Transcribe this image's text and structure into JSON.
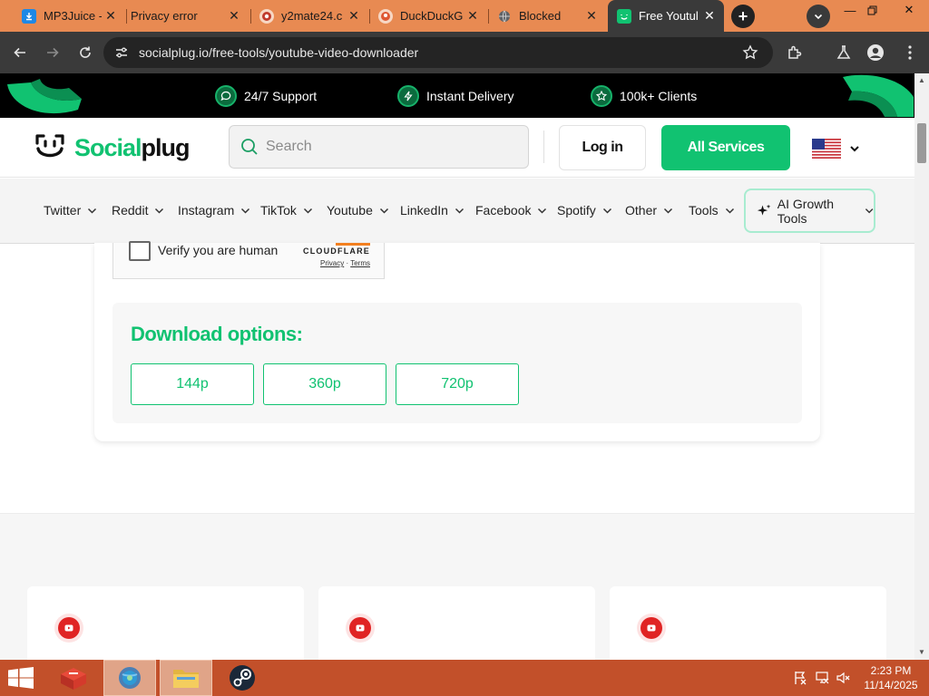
{
  "browser": {
    "tabs": [
      {
        "title": "MP3Juice -",
        "icon": "download-icon",
        "active": false
      },
      {
        "title": "Privacy error",
        "icon": "none",
        "active": false
      },
      {
        "title": "y2mate24.c",
        "icon": "y2mate-icon",
        "active": false
      },
      {
        "title": "DuckDuckG",
        "icon": "duckduckgo-icon",
        "active": false
      },
      {
        "title": "Blocked",
        "icon": "globe-icon",
        "active": false
      },
      {
        "title": "Free Youtul",
        "icon": "socialplug-icon",
        "active": true
      }
    ],
    "url": "socialplug.io/free-tools/youtube-video-downloader"
  },
  "promo": {
    "items": [
      {
        "label": "24/7 Support",
        "icon": "chat-icon"
      },
      {
        "label": "Instant Delivery",
        "icon": "bolt-icon"
      },
      {
        "label": "100k+ Clients",
        "icon": "star-icon"
      }
    ]
  },
  "header": {
    "brand_green": "Social",
    "brand_black": "plug",
    "search_placeholder": "Search",
    "login_label": "Log in",
    "all_services_label": "All Services",
    "language": "us-flag-icon"
  },
  "nav": {
    "items": [
      "Twitter",
      "Reddit",
      "Instagram",
      "TikTok",
      "Youtube",
      "LinkedIn",
      "Facebook",
      "Spotify",
      "Other",
      "Tools"
    ],
    "ai_tools_label": "AI Growth Tools"
  },
  "captcha": {
    "label": "Verify you are human",
    "provider": "CLOUDFLARE",
    "privacy": "Privacy",
    "terms": "Terms"
  },
  "download": {
    "title": "Download options:",
    "options": [
      "144p",
      "360p",
      "720p"
    ]
  },
  "taskbar": {
    "time": "2:23 PM",
    "date": "11/14/2025"
  },
  "colors": {
    "brand_green": "#11c271",
    "tabstrip": "#e88a52",
    "taskbar": "#c2502a",
    "chrome_dark": "#3a3a3a"
  }
}
